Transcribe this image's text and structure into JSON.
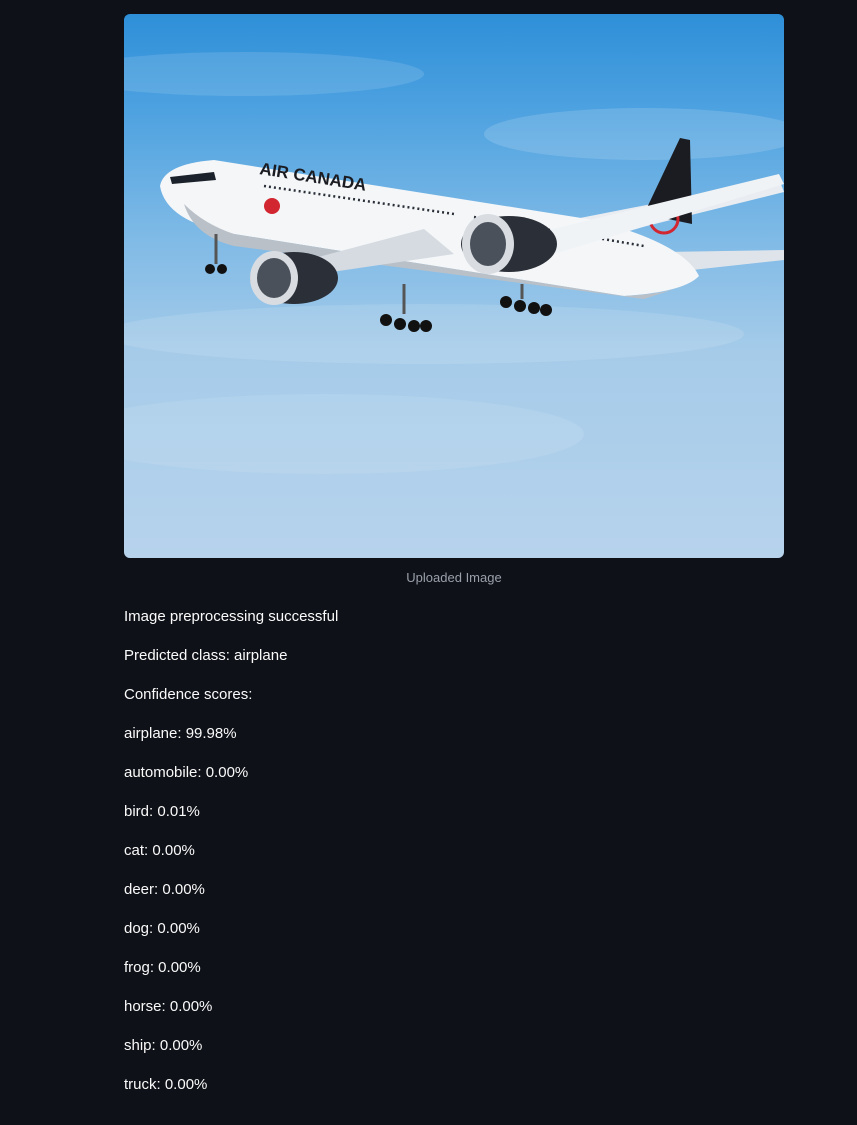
{
  "image": {
    "caption": "Uploaded Image",
    "airline_livery": "AIR CANADA",
    "sky_color_top": "#2e8fd8",
    "sky_color_bottom": "#b7d3ec"
  },
  "results": {
    "status": "Image preprocessing successful",
    "predicted": "Predicted class: airplane",
    "scores_header": "Confidence scores:",
    "scores": [
      "airplane: 99.98%",
      "automobile: 0.00%",
      "bird: 0.01%",
      "cat: 0.00%",
      "deer: 0.00%",
      "dog: 0.00%",
      "frog: 0.00%",
      "horse: 0.00%",
      "ship: 0.00%",
      "truck: 0.00%"
    ]
  },
  "colors": {
    "background": "#0e1117",
    "text": "#fafafa",
    "caption": "#9aa0aa",
    "livery_red": "#d22630"
  }
}
